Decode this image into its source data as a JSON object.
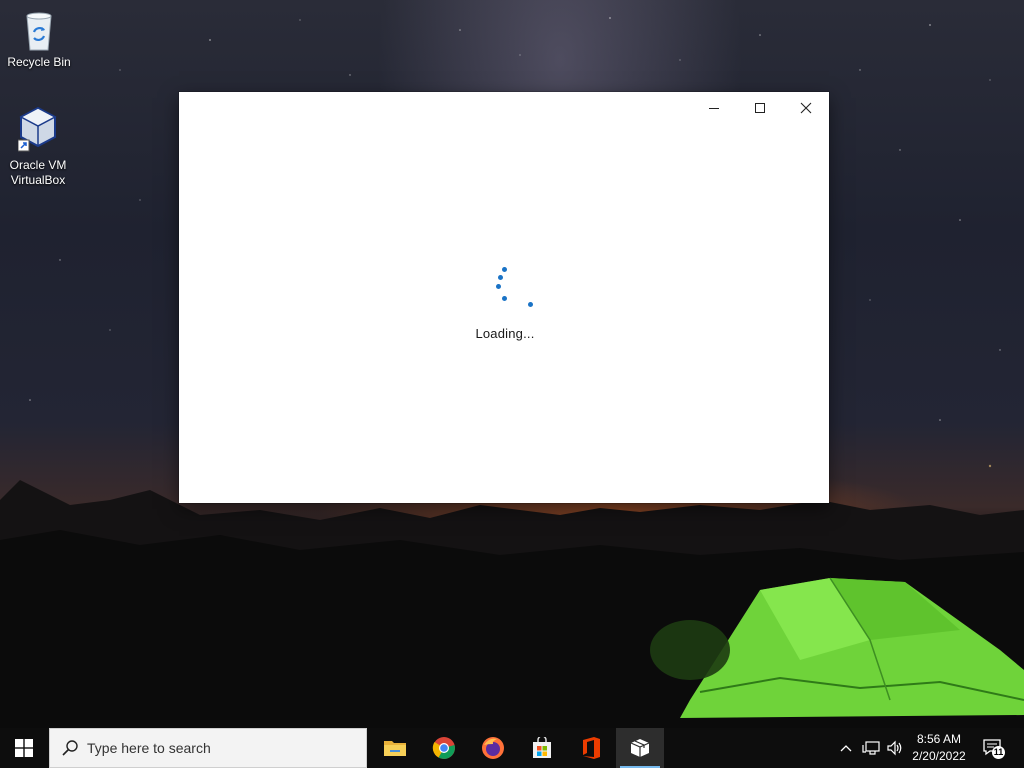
{
  "desktop": {
    "icons": [
      {
        "label": "Recycle Bin",
        "icon": "recycle-bin-icon"
      },
      {
        "label": "Oracle VM VirtualBox",
        "line1": "Oracle VM",
        "line2": "VirtualBox",
        "icon": "virtualbox-icon"
      }
    ]
  },
  "window": {
    "loading_text": "Loading...",
    "accent_color": "#1a73c6"
  },
  "taskbar": {
    "search_placeholder": "Type here to search",
    "pinned": [
      {
        "name": "file-explorer",
        "icon": "folder-icon"
      },
      {
        "name": "google-chrome",
        "icon": "chrome-icon"
      },
      {
        "name": "firefox",
        "icon": "firefox-icon"
      },
      {
        "name": "microsoft-store",
        "icon": "store-icon"
      },
      {
        "name": "office",
        "icon": "office-icon"
      },
      {
        "name": "package-app",
        "icon": "package-icon",
        "active": true
      }
    ],
    "clock": {
      "time": "8:56 AM",
      "date": "2/20/2022"
    },
    "notification_count": "11"
  }
}
